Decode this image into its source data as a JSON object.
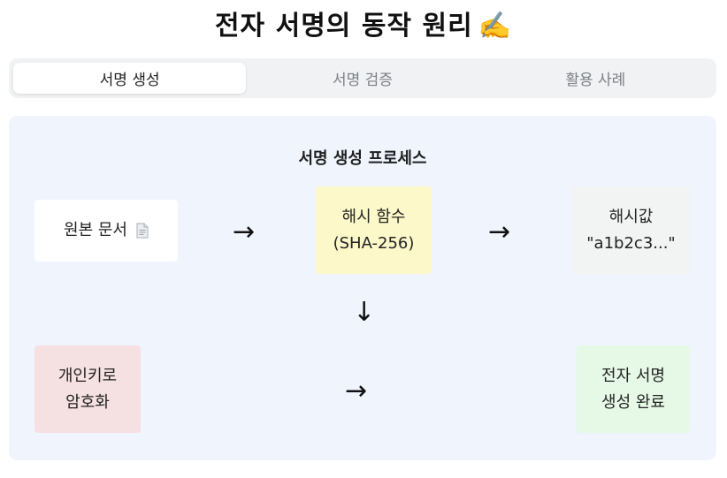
{
  "header": {
    "title": "전자 서명의 동작 원리",
    "title_emoji": "✍️"
  },
  "tabs": [
    {
      "label": "서명 생성",
      "active": true
    },
    {
      "label": "서명 검증",
      "active": false
    },
    {
      "label": "활용 사례",
      "active": false
    }
  ],
  "process": {
    "title": "서명 생성 프로세스",
    "steps": {
      "document": {
        "label": "원본 문서",
        "icon": "document-icon"
      },
      "hash_function": {
        "line1": "해시 함수",
        "line2": "(SHA-256)"
      },
      "hash_value": {
        "line1": "해시값",
        "line2": "\"a1b2c3...\""
      },
      "encrypt": {
        "line1": "개인키로",
        "line2": "암호화"
      },
      "complete": {
        "line1": "전자 서명",
        "line2": "생성 완료"
      }
    },
    "arrows": {
      "right": "→",
      "down": "↓"
    }
  },
  "colors": {
    "panel_bg": "#eff4fd",
    "hash_function_bg": "#fcf8c9",
    "hash_value_bg": "#f2f3f3",
    "encrypt_bg": "#f6e1e2",
    "complete_bg": "#e6f8e6"
  }
}
